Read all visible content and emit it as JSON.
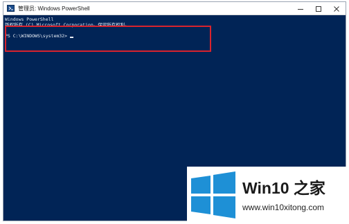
{
  "window": {
    "title": "管理员: Windows PowerShell",
    "icon": "powershell-icon",
    "controls": [
      "minimize-icon",
      "maximize-icon",
      "close-icon"
    ]
  },
  "console": {
    "lines": [
      "Windows PowerShell",
      "版权所有 (C) Microsoft Corporation。保留所有权利。"
    ],
    "prompt": "PS C:\\WINDOWS\\system32>"
  },
  "annotation": {
    "highlight_color": "#d9232d"
  },
  "watermark": {
    "brand": "Win10",
    "brand_cn": "之家",
    "url": "www.win10xitong.com",
    "logo": "windows-logo-icon"
  },
  "colors": {
    "console_bg": "#012456",
    "console_fg": "#e9edf5",
    "logo_blue": "#1e90d6"
  }
}
